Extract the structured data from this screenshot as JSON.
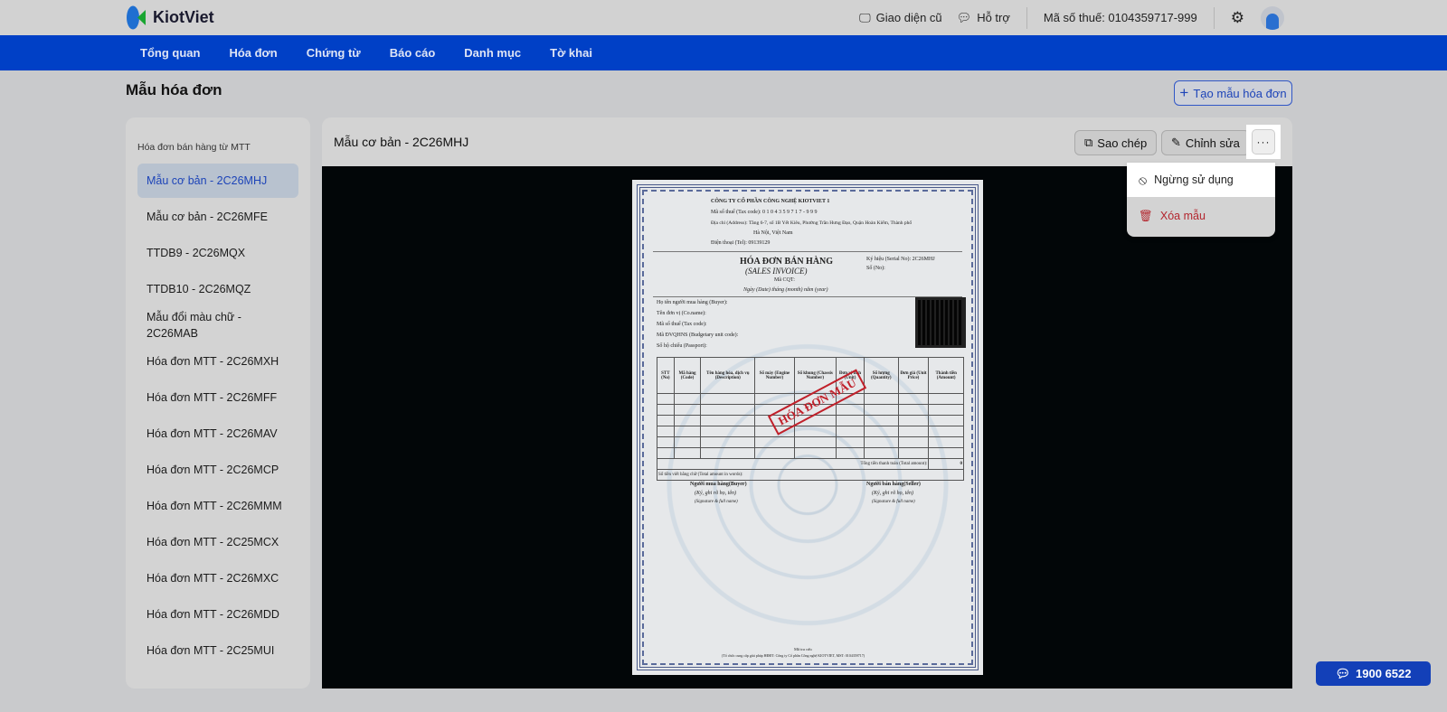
{
  "app": {
    "logo_text": "KiotViet"
  },
  "topbar": {
    "old_ui": "Giao diện cũ",
    "support": "Hỗ trợ",
    "tax_code": "Mã số thuế: 0104359717-999"
  },
  "nav": [
    "Tổng quan",
    "Hóa đơn",
    "Chứng từ",
    "Báo cáo",
    "Danh mục",
    "Tờ khai"
  ],
  "page": {
    "title": "Mẫu hóa đơn",
    "create_button": "Tạo mẫu hóa đơn"
  },
  "sidebar": {
    "group": "Hóa đơn bán hàng từ MTT",
    "items": [
      "Mẫu cơ bản - 2C26MHJ",
      "Mẫu cơ bản - 2C26MFE",
      "TTDB9 - 2C26MQX",
      "TTDB10 - 2C26MQZ",
      "Mẫu đổi màu chữ - 2C26MAB",
      "Hóa đơn MTT - 2C26MXH",
      "Hóa đơn MTT - 2C26MFF",
      "Hóa đơn MTT - 2C26MAV",
      "Hóa đơn MTT - 2C26MCP",
      "Hóa đơn MTT - 2C26MMM",
      "Hóa đơn MTT - 2C25MCX",
      "Hóa đơn MTT - 2C26MXC",
      "Hóa đơn MTT - 2C26MDD",
      "Hóa đơn MTT - 2C25MUI"
    ],
    "active_index": 0
  },
  "main": {
    "title": "Mẫu cơ bản - 2C26MHJ",
    "copy": "Sao chép",
    "edit": "Chỉnh sửa",
    "more": "···"
  },
  "dropdown": {
    "deactivate": "Ngừng sử dụng",
    "delete": "Xóa mẫu"
  },
  "hotline": "1900 6522",
  "invoice": {
    "company": "CÔNG TY CỔ PHẦN CÔNG NGHỆ KIOTVIET 1",
    "tax": "Mã số thuế (Tax code): 0 1 0 4 3 5 9 7 1 7 - 9 9 9",
    "address": "Địa chỉ (Address): Tầng 6-7, số 1B Yết Kiêu, Phường Trần Hưng Đạo, Quận Hoàn Kiếm, Thành phố",
    "address2": "Hà Nội, Việt Nam",
    "phone": "Điện thoại (Tel): 09139129",
    "title": "HÓA ĐƠN BÁN HÀNG",
    "subtitle": "(SALES INVOICE)",
    "cqt": "Mã CQT:",
    "date": "Ngày (Date) tháng (month) năm (year)",
    "serial": "Ký hiệu (Serial No): 2C26MHJ",
    "no": "Số (No):",
    "buyer": "Họ tên người mua hàng (Buyer):",
    "company_name": "Tên đơn vị (Co.name):",
    "buyer_tax": "Mã số thuế (Tax code):",
    "budget": "Mã ĐVQHNS (Budgetary unit code):",
    "passport": "Số hộ chiếu (Passport):",
    "columns": [
      "STT (No)",
      "Mã hàng (Code)",
      "Tên hàng hóa, dịch vụ (Description)",
      "Số máy (Engine Number)",
      "Số khung (Chassis Number)",
      "Đơn vị tính (Unit)",
      "Số lượng (Quantity)",
      "Đơn giá (Unit Price)",
      "Thành tiền (Amount)"
    ],
    "total": "Tổng tiền thanh toán (Total amount):",
    "total_value": "0",
    "in_words": "Số tiền viết bằng chữ (Total amount in words):",
    "buyer_sign": "Người mua hàng(Buyer)",
    "seller_sign": "Người bán hàng(Seller)",
    "sign_note": "(Ký, ghi rõ họ, tên)",
    "sign_note_en": "(Signature & full name)",
    "stamp": "HÓA ĐƠN MẪU",
    "lookup": "Mã tra cứu",
    "footer": "(Tổ chức cung cấp giải pháp HĐĐT: Công ty Cổ phần Công nghệ KIOTVIET, MST: 0104359717)"
  },
  "colors": {
    "nav": "#0040c6",
    "accent": "#1d44b8",
    "danger": "#b3262e"
  }
}
